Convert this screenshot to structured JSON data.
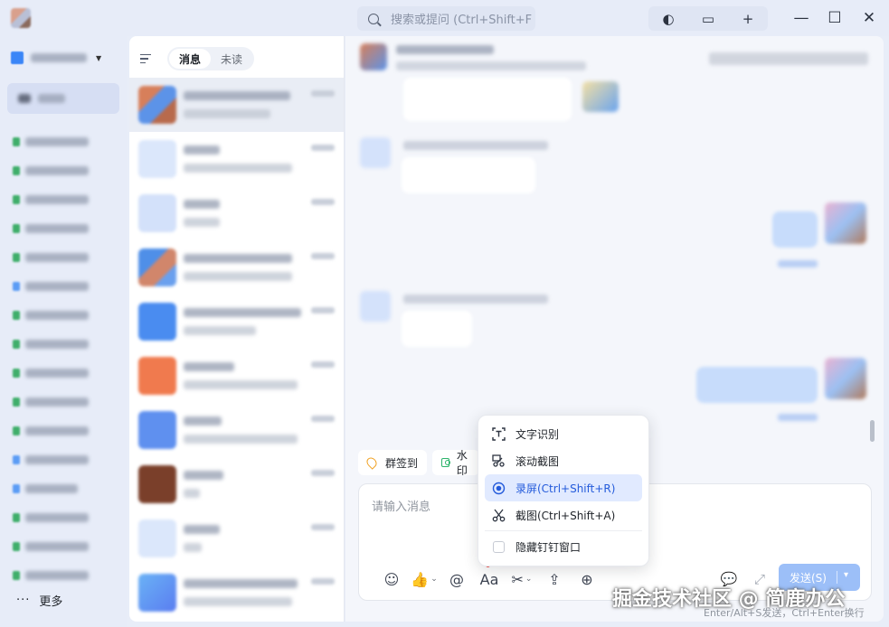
{
  "search": {
    "placeholder": "搜索或提问 (Ctrl+Shift+F"
  },
  "top_buttons": [
    "◐",
    "▭",
    "+"
  ],
  "window_controls": {
    "minimize": "—",
    "maximize": "☐",
    "close": "✕"
  },
  "left_nav": {
    "more_label": "更多",
    "more_dots": "···"
  },
  "conversation_list": {
    "tabs": [
      {
        "label": "消息",
        "active": true
      },
      {
        "label": "未读",
        "active": false
      }
    ]
  },
  "quick_actions": [
    {
      "label": "群签到",
      "icon": "location-pin-icon"
    },
    {
      "label": "水印",
      "icon": "camera-icon"
    }
  ],
  "composer": {
    "placeholder": "请输入消息",
    "send_label": "发送(S)",
    "send_arrow": "▾",
    "hint": "Enter/Alt+S发送，Ctrl+Enter换行"
  },
  "context_menu": {
    "items": [
      {
        "label": "文字识别",
        "icon": "text-recognition-icon",
        "highlighted": false
      },
      {
        "label": "滚动截图",
        "icon": "scroll-screenshot-icon",
        "highlighted": false
      },
      {
        "label": "录屏(Ctrl+Shift+R)",
        "icon": "screen-record-icon",
        "highlighted": true
      },
      {
        "label": "截图(Ctrl+Shift+A)",
        "icon": "scissors-icon",
        "highlighted": false
      }
    ],
    "checkbox_label": "隐藏钉钉窗口"
  },
  "watermark": "掘金技术社区 @ 简鹿办公",
  "colors": {
    "accent": "#245bdb",
    "highlight_bg": "#e1eaff",
    "send_button": "#9cbff8",
    "unread_dot": "#f54a45"
  }
}
